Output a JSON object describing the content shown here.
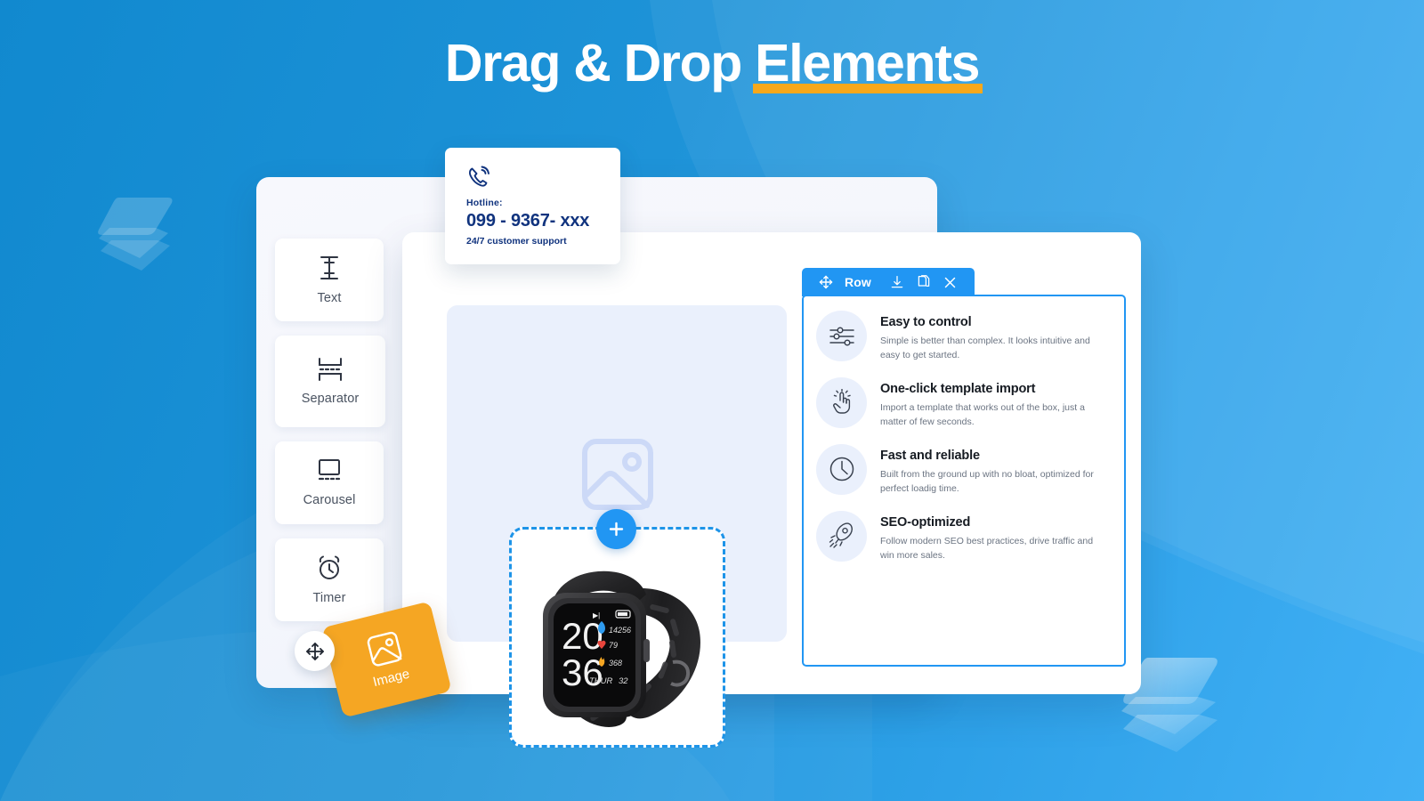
{
  "headline": {
    "text_plain": "Drag & Drop ",
    "text_accent": "Elements",
    "accent_color": "#f7a81b"
  },
  "colors": {
    "background_start": "#1189cf",
    "background_end": "#41b0f5",
    "primary_blue": "#2196f3",
    "tile_orange": "#f5a623",
    "hotline_navy": "#10337e",
    "badge_bg": "#eaf0fc"
  },
  "palette": {
    "items": [
      {
        "label": "Text",
        "icon": "text-cursor-icon"
      },
      {
        "label": "Separator",
        "icon": "separator-icon"
      },
      {
        "label": "Carousel",
        "icon": "carousel-icon"
      },
      {
        "label": "Timer",
        "icon": "alarm-clock-icon"
      }
    ]
  },
  "hotline_card": {
    "icon": "phone-ring-icon",
    "label": "Hotline:",
    "number": "099 - 9367- xxx",
    "sub": "24/7 customer support"
  },
  "canvas": {
    "placeholder_icon": "image-placeholder-icon",
    "dropzone": {
      "add_button_label": "+",
      "add_icon": "plus-icon"
    },
    "product": {
      "name": "smartwatch-photo",
      "watch_face": {
        "hour": "20",
        "minute": "36",
        "steps": "14256",
        "heart_rate": "79",
        "calories": "368",
        "day_date": "THUR  32"
      }
    }
  },
  "drag_tile": {
    "label": "Image",
    "icon": "image-icon",
    "handle_icon": "move-arrows-icon"
  },
  "row_toolbar": {
    "move_icon": "move-arrows-icon",
    "label": "Row",
    "save_icon": "download-icon",
    "duplicate_icon": "copy-icon",
    "close_icon": "close-icon"
  },
  "features": [
    {
      "icon": "sliders-icon",
      "title": "Easy to control",
      "desc": "Simple is better than complex. It looks intuitive and easy to get started."
    },
    {
      "icon": "click-hand-icon",
      "title": "One-click template import",
      "desc": "Import a template that works out of the box, just a matter of few seconds."
    },
    {
      "icon": "clock-icon",
      "title": "Fast and reliable",
      "desc": "Built from the ground up with no bloat, optimized for perfect loadig time."
    },
    {
      "icon": "rocket-icon",
      "title": "SEO-optimized",
      "desc": "Follow modern SEO best practices, drive traffic and win more sales."
    }
  ],
  "decorations": {
    "left_stack_icon": "layers-stack-icon",
    "right_stack_icon": "layers-stack-icon"
  }
}
